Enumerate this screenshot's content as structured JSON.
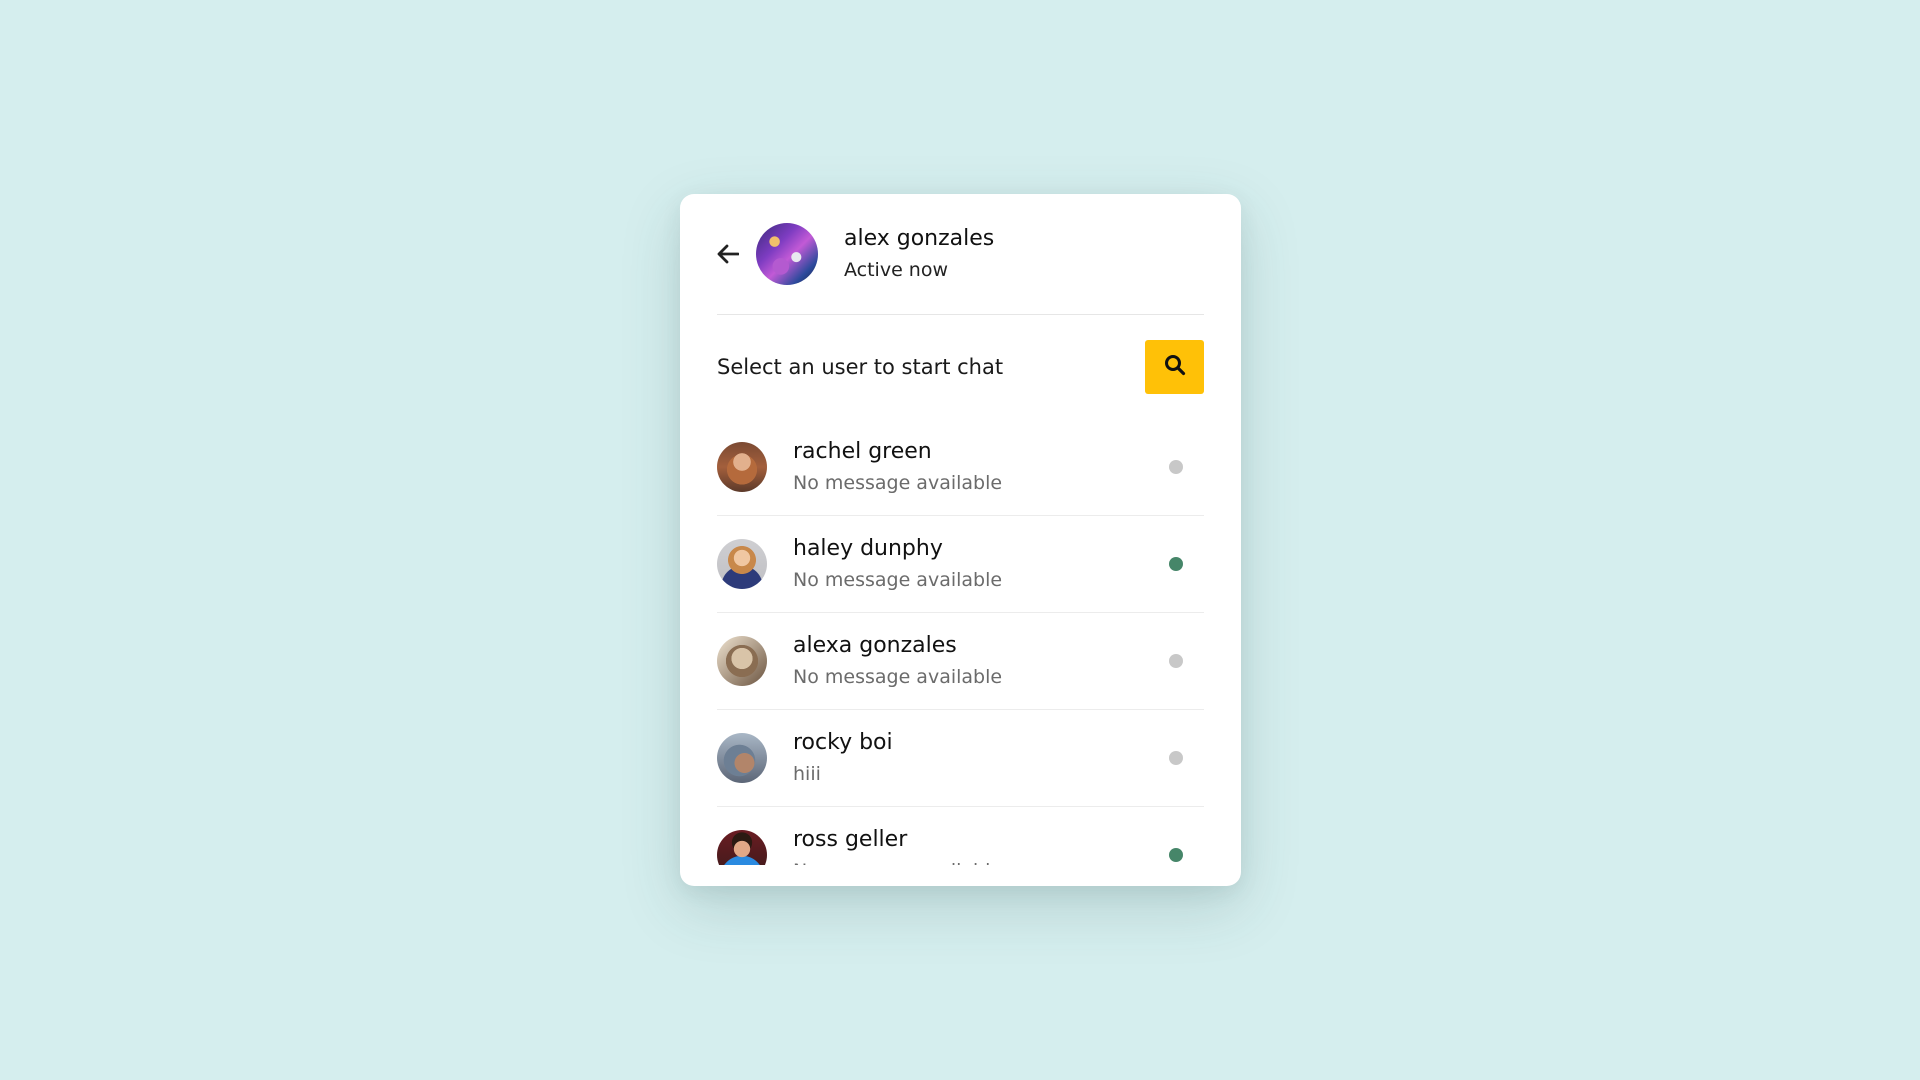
{
  "header": {
    "name": "alex gonzales",
    "status": "Active now"
  },
  "search": {
    "text": "Select an user to start chat",
    "icon": "search-icon"
  },
  "users": [
    {
      "name": "rachel green",
      "message": "No message available",
      "online": false
    },
    {
      "name": "haley dunphy",
      "message": "No message available",
      "online": true
    },
    {
      "name": "alexa gonzales",
      "message": "No message available",
      "online": false
    },
    {
      "name": "rocky boi",
      "message": "hiii",
      "online": false
    },
    {
      "name": "ross geller",
      "message": "No message available",
      "online": true
    }
  ],
  "colors": {
    "background": "#d5eeee",
    "accent": "#ffc107",
    "online": "#468669",
    "offline": "#c8c8c8"
  }
}
